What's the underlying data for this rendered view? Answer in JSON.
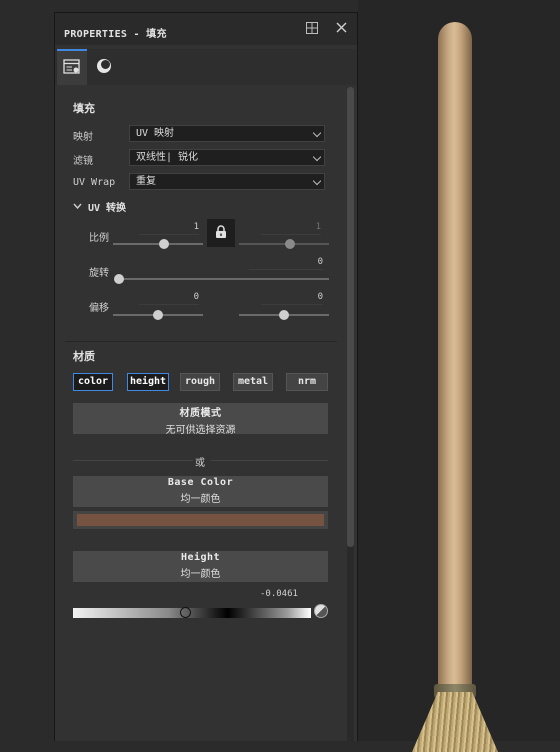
{
  "panel": {
    "title": "PROPERTIES - 填充",
    "tabs": [
      {
        "name": "layer-properties-tab",
        "icon": "layer-settings-icon",
        "active": true
      },
      {
        "name": "material-ball-tab",
        "icon": "material-ball-icon",
        "active": false
      }
    ]
  },
  "fill": {
    "section_title": "填充",
    "mapping_label": "映射",
    "mapping_value": "UV 映射",
    "filter_label": "滤镜",
    "filter_value": "双线性| 锐化",
    "uvwrap_label": "UV Wrap",
    "uvwrap_value": "重复"
  },
  "uv_transform": {
    "title": "UV 转换",
    "scale_label": "比例",
    "scale_value_left": "1",
    "scale_value_right": "1",
    "scale_left_fraction": 0.57,
    "scale_right_fraction": 0.57,
    "rotation_label": "旋转",
    "rotation_value": "0",
    "rotation_fraction": 0.0,
    "offset_label": "偏移",
    "offset_value_left": "0",
    "offset_value_right": "0",
    "offset_left_fraction": 0.5,
    "offset_right_fraction": 0.5
  },
  "material": {
    "section_title": "材质",
    "channels": [
      {
        "label": "color",
        "selected": true
      },
      {
        "label": "height",
        "selected": true
      },
      {
        "label": "rough",
        "selected": false
      },
      {
        "label": "metal",
        "selected": false
      },
      {
        "label": "nrm",
        "selected": false
      }
    ],
    "mode_title": "材质模式",
    "mode_sub": "无可供选择资源",
    "or_label": "或",
    "base_color_title": "Base Color",
    "base_color_sub": "均一颜色",
    "base_color_hex": "#765241",
    "height_title": "Height",
    "height_sub": "均一颜色",
    "height_value": "-0.0461",
    "height_fraction": 0.47
  },
  "colors": {
    "accent": "#3f8ae0",
    "panel_bg": "#323232"
  }
}
